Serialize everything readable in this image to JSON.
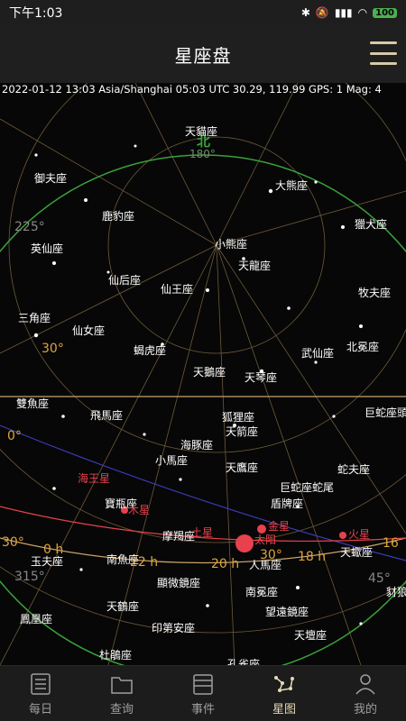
{
  "status_bar": {
    "time": "下午1:03",
    "battery": "100"
  },
  "header": {
    "title": "星座盘"
  },
  "chart": {
    "info": "2022-01-12 13:03 Asia/Shanghai  05:03 UTC  30.29, 119.99 GPS: 1  Mag: 4",
    "direction_north": "北",
    "direction_north_deg": "180°",
    "azimuth_labels": [
      {
        "id": "a225",
        "text": "225°"
      },
      {
        "id": "a315",
        "text": "315°"
      },
      {
        "id": "a45",
        "text": "45°"
      }
    ],
    "dec_labels": [
      {
        "id": "d30a",
        "text": "30°"
      },
      {
        "id": "d0",
        "text": "0°"
      },
      {
        "id": "d30b",
        "text": "30°"
      },
      {
        "id": "d30c",
        "text": "30°"
      }
    ],
    "ra_labels": [
      {
        "id": "r0",
        "text": "0 h"
      },
      {
        "id": "r22",
        "text": "22 h"
      },
      {
        "id": "r20",
        "text": "20 h"
      },
      {
        "id": "r18",
        "text": "18 h"
      },
      {
        "id": "r16",
        "text": "16"
      }
    ],
    "constellations": [
      {
        "id": "c1",
        "text": "天貓座"
      },
      {
        "id": "c2",
        "text": "御夫座"
      },
      {
        "id": "c3",
        "text": "大熊座"
      },
      {
        "id": "c4",
        "text": "鹿豹座"
      },
      {
        "id": "c5",
        "text": "獵犬座"
      },
      {
        "id": "c6",
        "text": "英仙座"
      },
      {
        "id": "c7",
        "text": "小熊座"
      },
      {
        "id": "c8",
        "text": "天龍座"
      },
      {
        "id": "c9",
        "text": "仙后座"
      },
      {
        "id": "c10",
        "text": "仙王座"
      },
      {
        "id": "c11",
        "text": "牧夫座"
      },
      {
        "id": "c12",
        "text": "三角座"
      },
      {
        "id": "c13",
        "text": "仙女座"
      },
      {
        "id": "c14",
        "text": "蝎虎座"
      },
      {
        "id": "c15",
        "text": "武仙座"
      },
      {
        "id": "c16",
        "text": "北冕座"
      },
      {
        "id": "c17",
        "text": "天鵝座"
      },
      {
        "id": "c18",
        "text": "天琴座"
      },
      {
        "id": "c19",
        "text": "雙魚座"
      },
      {
        "id": "c20",
        "text": "飛馬座"
      },
      {
        "id": "c21",
        "text": "狐狸座"
      },
      {
        "id": "c22",
        "text": "天箭座"
      },
      {
        "id": "c23",
        "text": "巨蛇座頭"
      },
      {
        "id": "c24",
        "text": "海豚座"
      },
      {
        "id": "c25",
        "text": "小馬座"
      },
      {
        "id": "c26",
        "text": "天鷹座"
      },
      {
        "id": "c27",
        "text": "巨蛇座蛇尾"
      },
      {
        "id": "c28",
        "text": "蛇夫座"
      },
      {
        "id": "c29",
        "text": "盾牌座"
      },
      {
        "id": "c30",
        "text": "寶瓶座"
      },
      {
        "id": "c31",
        "text": "摩羯座"
      },
      {
        "id": "c32",
        "text": "南魚座"
      },
      {
        "id": "c33",
        "text": "人馬座"
      },
      {
        "id": "c34",
        "text": "天蠍座"
      },
      {
        "id": "c35",
        "text": "玉夫座"
      },
      {
        "id": "c36",
        "text": "顯微鏡座"
      },
      {
        "id": "c37",
        "text": "南冕座"
      },
      {
        "id": "c38",
        "text": "天鶴座"
      },
      {
        "id": "c39",
        "text": "望遠鏡座"
      },
      {
        "id": "c40",
        "text": "鳳凰座"
      },
      {
        "id": "c41",
        "text": "印第安座"
      },
      {
        "id": "c42",
        "text": "天壇座"
      },
      {
        "id": "c43",
        "text": "杜鵑座"
      },
      {
        "id": "c44",
        "text": "孔雀座"
      },
      {
        "id": "c45",
        "text": "豺狼"
      }
    ],
    "planets": [
      {
        "id": "p1",
        "text": "海王星",
        "color": "#e8414d"
      },
      {
        "id": "p2",
        "text": "木星",
        "color": "#e8414d"
      },
      {
        "id": "p3",
        "text": "土星",
        "color": "#e8414d"
      },
      {
        "id": "p4",
        "text": "金星",
        "color": "#e8414d"
      },
      {
        "id": "p5",
        "text": "太阳",
        "color": "#e8414d"
      },
      {
        "id": "p6",
        "text": "火星",
        "color": "#e8414d"
      }
    ]
  },
  "bottom_nav": [
    {
      "id": "daily",
      "label": "每日"
    },
    {
      "id": "query",
      "label": "查询"
    },
    {
      "id": "events",
      "label": "事件"
    },
    {
      "id": "starmap",
      "label": "星图"
    },
    {
      "id": "mine",
      "label": "我的"
    }
  ],
  "colors": {
    "grid": "#c9a46a",
    "horizon": "#3aa13a",
    "ecliptic": "#e8414d",
    "label": "#ffffff",
    "nav_active": "#e6d9b8",
    "nav_inactive": "#9e9e9e"
  }
}
